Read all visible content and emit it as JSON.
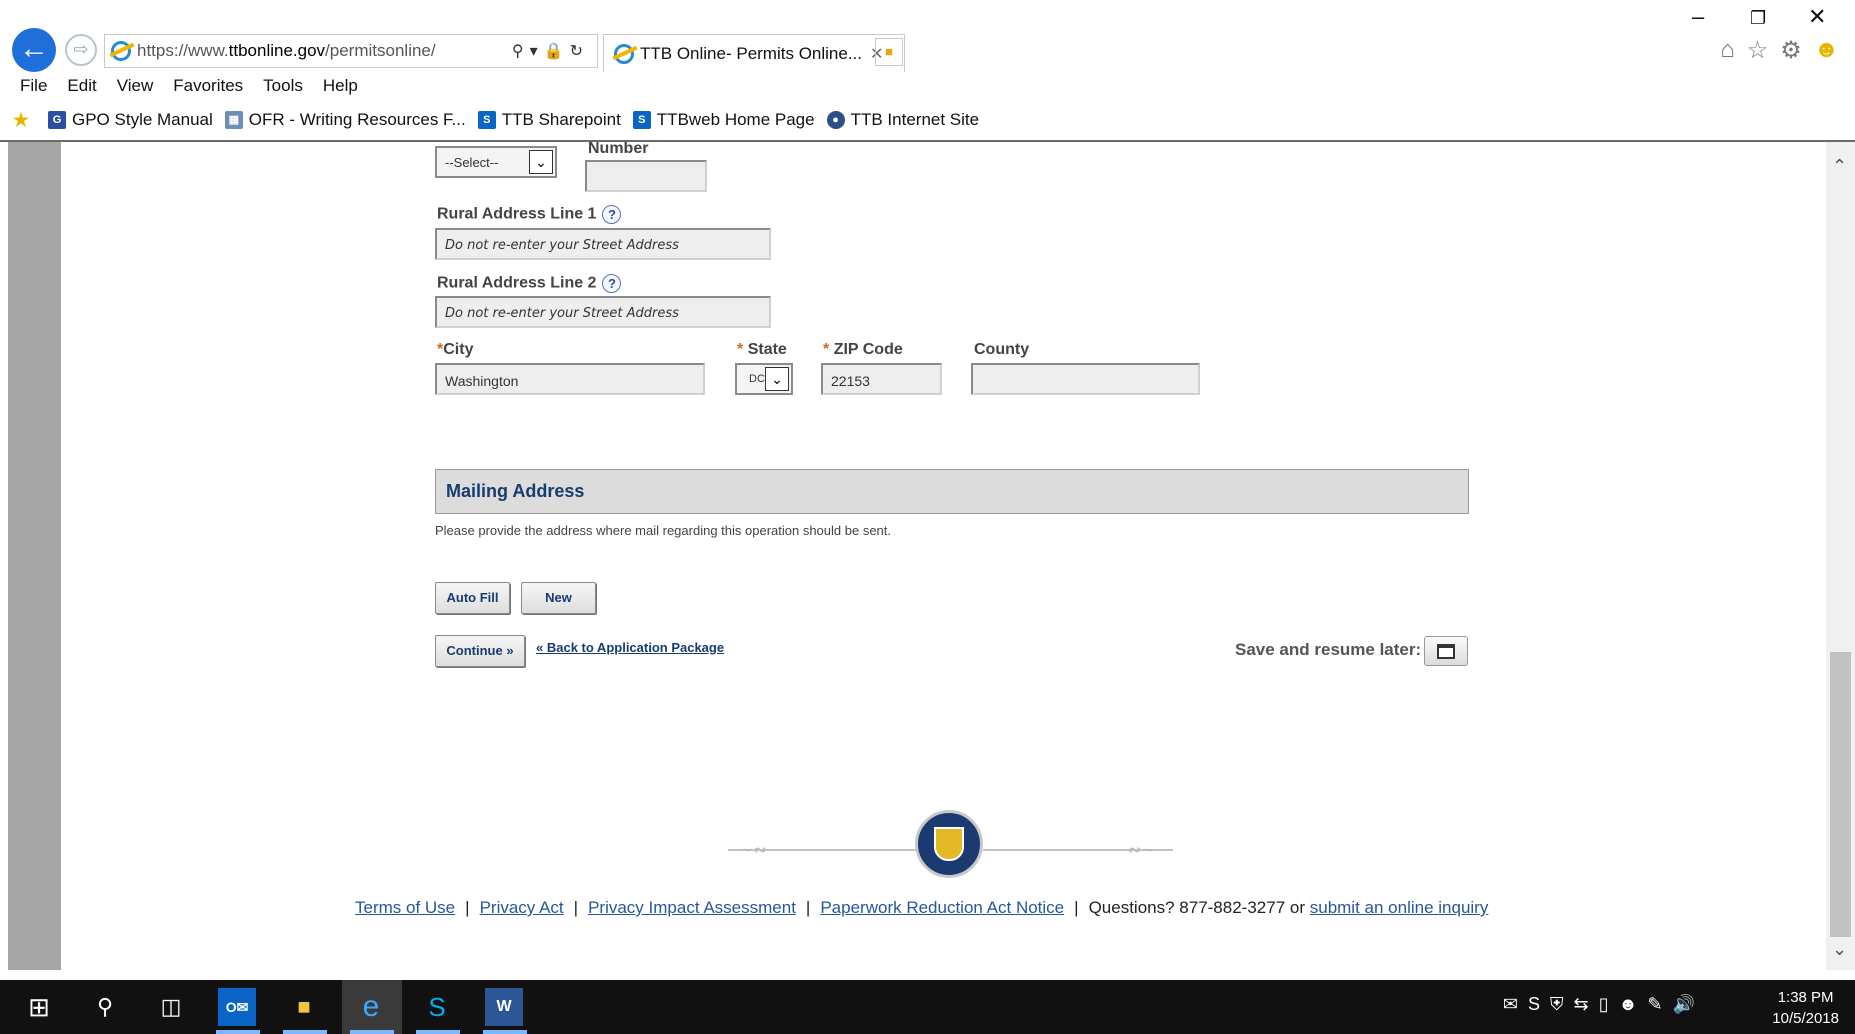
{
  "browser": {
    "url_scheme": "https://www.",
    "url_host": "ttbonline.gov",
    "url_path": "/permitsonline/",
    "tab_title": "TTB Online- Permits Online...",
    "menu": [
      "File",
      "Edit",
      "View",
      "Favorites",
      "Tools",
      "Help"
    ],
    "favorites": [
      "GPO Style Manual",
      "OFR - Writing Resources F...",
      "TTB Sharepoint",
      "TTBweb Home Page",
      "TTB Internet Site"
    ]
  },
  "form": {
    "select_partial": "--Select--",
    "number_label": "Number",
    "rural1_label": "Rural Address Line 1",
    "rural1_placeholder": "Do not re-enter your Street Address",
    "rural2_label": "Rural Address Line 2",
    "rural2_placeholder": "Do not re-enter your Street Address",
    "city_label": "City",
    "city_value": "Washington",
    "state_label": "State",
    "state_value": "DC",
    "zip_label": "ZIP Code",
    "zip_value": "22153",
    "county_label": "County",
    "county_value": "",
    "required_mark": "*",
    "help_glyph": "?"
  },
  "mailing": {
    "header": "Mailing Address",
    "description": "Please provide the address where mail regarding this operation should be sent.",
    "autofill_label": "Auto Fill",
    "new_label": "New",
    "continue_label": "Continue »",
    "back_link": "« Back to Application Package",
    "save_label": "Save and resume later:"
  },
  "footer": {
    "terms": "Terms of Use",
    "privacy": "Privacy Act",
    "pia": "Privacy Impact Assessment",
    "paperwork": "Paperwork Reduction Act Notice",
    "questions": "Questions? 877-882-3277 or",
    "inquiry": "submit an online inquiry",
    "separator": "|"
  },
  "taskbar": {
    "time": "1:38 PM",
    "date": "10/5/2018"
  },
  "icons": {
    "back": "back-arrow-icon",
    "forward": "forward-arrow-icon",
    "home": "home-icon",
    "favorites": "star-icon",
    "settings": "gear-icon",
    "feedback": "smiley-icon"
  }
}
